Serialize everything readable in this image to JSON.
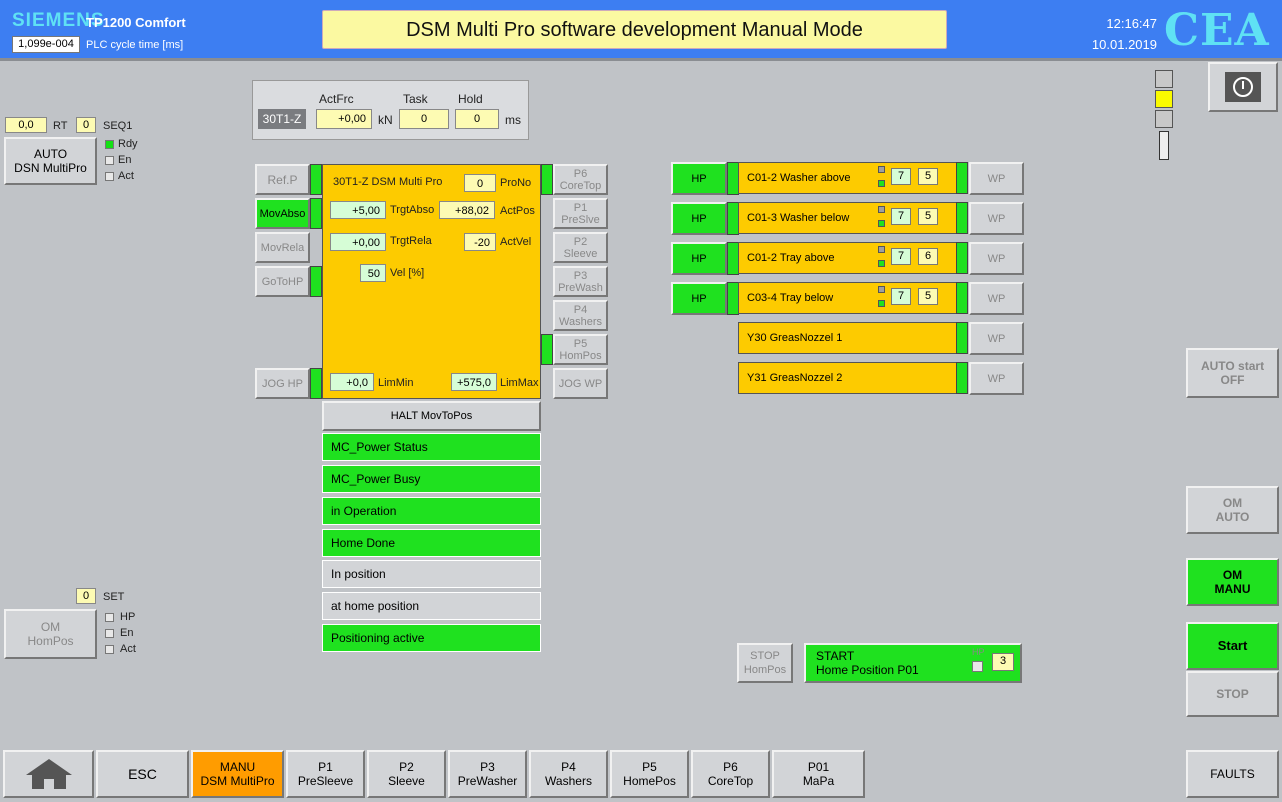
{
  "header": {
    "brand": "SIEMENS",
    "panel": "TP1200 Comfort",
    "cycle_value": "1,099e-004",
    "cycle_label": "PLC cycle time [ms]",
    "title": "DSM Multi Pro software development Manual Mode",
    "time": "12:16:47",
    "date": "10.01.2019",
    "logo": "CEA"
  },
  "left": {
    "rt_value": "0,0",
    "rt_label": "RT",
    "seq_value": "0",
    "seq_label": "SEQ1",
    "auto_button": [
      "AUTO",
      "DSN MultiPro"
    ],
    "auto_checks": [
      {
        "label": "Rdy",
        "on": true
      },
      {
        "label": "En",
        "on": false
      },
      {
        "label": "Act",
        "on": false
      }
    ],
    "set_value": "0",
    "set_label": "SET",
    "om_button": [
      "OM",
      "HomPos"
    ],
    "om_checks": [
      {
        "label": "HP",
        "on": false
      },
      {
        "label": "En",
        "on": false
      },
      {
        "label": "Act",
        "on": false
      }
    ]
  },
  "force": {
    "axis": "30T1-Z",
    "actfrc_label": "ActFrc",
    "actfrc": "+0,00",
    "kn": "kN",
    "task_label": "Task",
    "task": "0",
    "hold_label": "Hold",
    "hold": "0",
    "ms": "ms"
  },
  "axis_panel": {
    "title": "30T1-Z DSM Multi Pro",
    "prono": "0",
    "prono_label": "ProNo",
    "trgtabso": "+5,00",
    "trgtabso_label": "TrgtAbso",
    "actpos": "+88,02",
    "actpos_label": "ActPos",
    "trgtrela": "+0,00",
    "trgtrela_label": "TrgtRela",
    "actvel": "-20",
    "actvel_label": "ActVel",
    "vel": "50",
    "vel_label": "Vel [%]",
    "limmin": "+0,0",
    "limmin_label": "LimMin",
    "limmax": "+575,0",
    "limmax_label": "LimMax",
    "halt": "HALT MovToPos"
  },
  "left_buttons": [
    "Ref.P",
    "MovAbso",
    "MovRela",
    "GoToHP",
    "JOG HP"
  ],
  "pos_buttons": [
    [
      "P6",
      "CoreTop"
    ],
    [
      "P1",
      "PreSlve"
    ],
    [
      "P2",
      "Sleeve"
    ],
    [
      "P3",
      "PreWash"
    ],
    [
      "P4",
      "Washers"
    ],
    [
      "P5",
      "HomPos"
    ]
  ],
  "jog_wp": "JOG WP",
  "statuses": [
    {
      "text": "MC_Power Status",
      "on": true
    },
    {
      "text": "MC_Power Busy",
      "on": true
    },
    {
      "text": "in Operation",
      "on": true
    },
    {
      "text": "Home Done",
      "on": true
    },
    {
      "text": "In position",
      "on": false
    },
    {
      "text": "at home position",
      "on": false
    },
    {
      "text": "Positioning active",
      "on": true
    }
  ],
  "valves": [
    {
      "hp": "HP",
      "name": "C01-2 Washer above",
      "v1": "7",
      "v2": "5",
      "wp": "WP"
    },
    {
      "hp": "HP",
      "name": "C01-3 Washer below",
      "v1": "7",
      "v2": "5",
      "wp": "WP"
    },
    {
      "hp": "HP",
      "name": "C01-2 Tray above",
      "v1": "7",
      "v2": "6",
      "wp": "WP"
    },
    {
      "hp": "HP",
      "name": "C03-4 Tray below",
      "v1": "7",
      "v2": "5",
      "wp": "WP"
    },
    {
      "hp": "",
      "name": "Y30 GreasNozzel 1",
      "v1": "",
      "v2": "",
      "wp": "WP"
    },
    {
      "hp": "",
      "name": "Y31 GreasNozzel 2",
      "v1": "",
      "v2": "",
      "wp": "WP"
    }
  ],
  "homing": {
    "stop": [
      "STOP",
      "HomPos"
    ],
    "start": [
      "START",
      "Home Position P01"
    ],
    "hp": "HP",
    "value": "3"
  },
  "right": {
    "auto_start": [
      "AUTO start",
      "OFF"
    ],
    "om_auto": [
      "OM",
      "AUTO"
    ],
    "om_manu": [
      "OM",
      "MANU"
    ],
    "start": "Start",
    "stop": "STOP"
  },
  "nav": [
    [
      "ESC"
    ],
    [
      "MANU",
      "DSM MultiPro"
    ],
    [
      "P1",
      "PreSleeve"
    ],
    [
      "P2",
      "Sleeve"
    ],
    [
      "P3",
      "PreWasher"
    ],
    [
      "P4",
      "Washers"
    ],
    [
      "P5",
      "HomePos"
    ],
    [
      "P6",
      "CoreTop"
    ],
    [
      "P01",
      "MaPa"
    ]
  ],
  "faults": "FAULTS",
  "colors": {
    "green": "#1fe11f",
    "orange": "#fdcb00",
    "header": "#3d7ef2",
    "yellow_field": "#fdfbb3"
  }
}
